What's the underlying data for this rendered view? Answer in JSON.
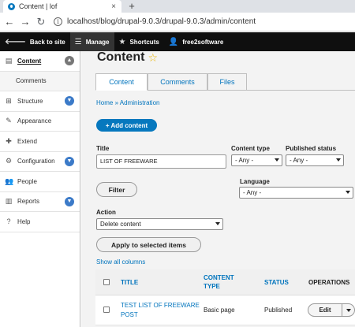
{
  "browser": {
    "tab_title": "Content | lof",
    "tab_close": "×",
    "new_tab": "+",
    "url": "localhost/blog/drupal-9.0.3/drupal-9.0.3/admin/content"
  },
  "toolbar": {
    "back_to_site": "Back to site",
    "manage": "Manage",
    "shortcuts": "Shortcuts",
    "user": "free2software"
  },
  "sidebar": {
    "items": [
      {
        "label": "Content"
      },
      {
        "label": "Comments"
      },
      {
        "label": "Structure"
      },
      {
        "label": "Appearance"
      },
      {
        "label": "Extend"
      },
      {
        "label": "Configuration"
      },
      {
        "label": "People"
      },
      {
        "label": "Reports"
      },
      {
        "label": "Help"
      }
    ]
  },
  "main": {
    "title": "Content",
    "tabs": [
      {
        "label": "Content"
      },
      {
        "label": "Comments"
      },
      {
        "label": "Files"
      }
    ],
    "breadcrumb": "Home » Administration",
    "add_content": "+ Add content",
    "filters": {
      "title_label": "Title",
      "title_value": "LIST OF FREEWARE",
      "content_type_label": "Content type",
      "content_type_value": "- Any -",
      "published_label": "Published status",
      "published_value": "- Any -",
      "language_label": "Language",
      "language_value": "- Any -",
      "filter_button": "Filter"
    },
    "action": {
      "label": "Action",
      "value": "Delete content",
      "apply_button": "Apply to selected items"
    },
    "show_columns": "Show all columns",
    "table": {
      "headers": {
        "title": "TITLE",
        "content_type_line1": "CONTENT",
        "content_type_line2": "TYPE",
        "status": "STATUS",
        "operations": "OPERATIONS"
      },
      "rows": [
        {
          "title_line1": "TEST LIST OF FREEWARE",
          "title_line2": "POST",
          "type": "Basic page",
          "status": "Published",
          "edit": "Edit"
        }
      ]
    }
  }
}
